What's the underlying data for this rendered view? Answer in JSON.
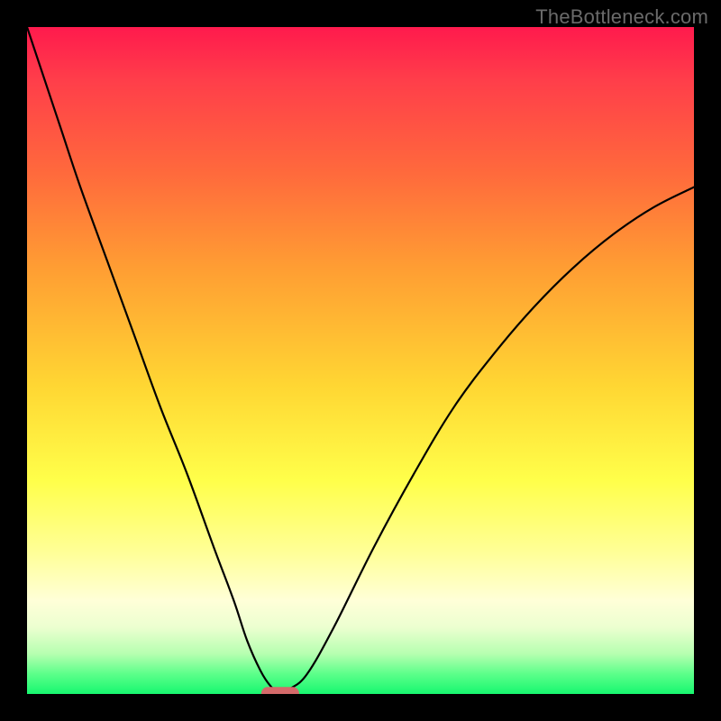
{
  "watermark": "TheBottleneck.com",
  "chart_data": {
    "type": "line",
    "title": "",
    "xlabel": "",
    "ylabel": "",
    "xlim": [
      0,
      100
    ],
    "ylim": [
      0,
      100
    ],
    "grid": false,
    "legend": false,
    "series": [
      {
        "name": "bottleneck-curve",
        "x": [
          0,
          2,
          5,
          8,
          12,
          16,
          20,
          24,
          28,
          31,
          33,
          35,
          36.5,
          38,
          39.5,
          42,
          46,
          52,
          58,
          64,
          70,
          76,
          82,
          88,
          94,
          100
        ],
        "y": [
          100,
          94,
          85,
          76,
          65,
          54,
          43,
          33,
          22,
          14,
          8,
          3.5,
          1.2,
          0,
          0.8,
          3,
          10,
          22,
          33,
          43,
          51,
          58,
          64,
          69,
          73,
          76
        ]
      }
    ],
    "marker": {
      "x": 38,
      "y": 0,
      "width_pct": 5.7,
      "color": "#d46a6a"
    },
    "background_gradient": {
      "top": "#ff1a4d",
      "mid": "#ffff4a",
      "bottom": "#17f76f"
    }
  }
}
